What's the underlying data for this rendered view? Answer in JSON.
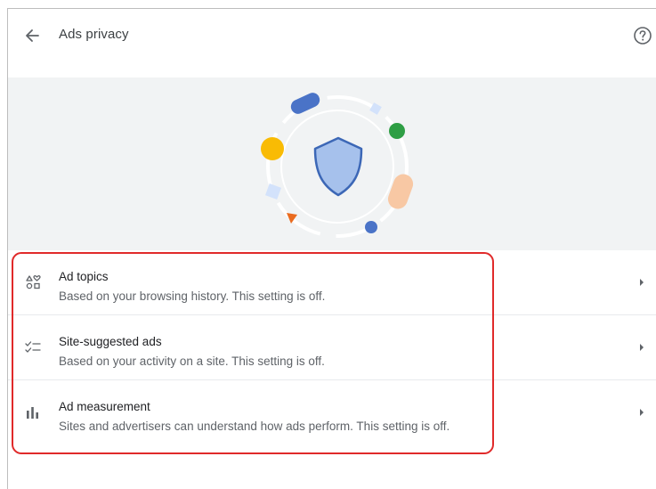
{
  "header": {
    "title": "Ads privacy",
    "back_icon": "arrow-back-icon",
    "help_icon": "help-icon"
  },
  "hero": {
    "illustration": "shield-illustration",
    "colors": {
      "shield_fill": "#a6c1ec",
      "shield_stroke": "#3c67b6",
      "blue": "#4a73c7",
      "yellow": "#f9bb04",
      "green": "#2e9e44",
      "peach": "#f8c8a4",
      "orange": "#ea6b1f",
      "light_blue": "#d3e2fb"
    }
  },
  "settings": [
    {
      "title": "Ad topics",
      "subtitle": "Based on your browsing history. This setting is off.",
      "icon": "ad-topics-icon"
    },
    {
      "title": "Site-suggested ads",
      "subtitle": "Based on your activity on a site. This setting is off.",
      "icon": "checklist-icon"
    },
    {
      "title": "Ad measurement",
      "subtitle": "Sites and advertisers can understand how ads perform. This setting is off.",
      "icon": "bar-chart-icon"
    }
  ],
  "colors": {
    "highlight": "#e02a2a",
    "hero_background": "#f1f3f4",
    "secondary_text": "#5f6368"
  }
}
